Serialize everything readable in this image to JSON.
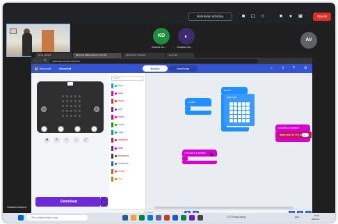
{
  "meet": {
    "record_button": "Nahrávání schůzky",
    "leave_button": "Opustit",
    "participants": [
      {
        "initials": "KD",
        "name": "Kristina Do...",
        "color": "#1e8e3e"
      },
      {
        "initials": "",
        "name": "Oswaldo Na...",
        "color": "#3c2a6e"
      },
      {
        "initials": "AV",
        "name": "",
        "color": "#5f6368"
      }
    ],
    "presenter_label": "Oswaldo Nazarov"
  },
  "browser": {
    "tabs": [
      "Nová záložka",
      "Microsoft MakeCode for micro:bit",
      "Microbit V2 | Tutorial",
      "Nový tab"
    ],
    "url": "makecode.microbit.org/#editor"
  },
  "makecode": {
    "brand": "Microsoft",
    "product": "micro:bit",
    "blocks_tab": "Blocks",
    "js_tab": "JavaScript",
    "download_label": "Download",
    "search_placeholder": "Search...",
    "project_name": "Untitled",
    "categories": [
      {
        "label": "Basic",
        "color": "#1e90ff"
      },
      {
        "label": "Input",
        "color": "#d400d4"
      },
      {
        "label": "Music",
        "color": "#e63022"
      },
      {
        "label": "Led",
        "color": "#5c2d91"
      },
      {
        "label": "Radio",
        "color": "#e3008c"
      },
      {
        "label": "Loops",
        "color": "#00aa00"
      },
      {
        "label": "Logic",
        "color": "#00a4a6"
      },
      {
        "label": "Variables",
        "color": "#dc143c"
      },
      {
        "label": "Math",
        "color": "#9400d3"
      },
      {
        "label": "Advanced",
        "color": "#3c3c3c"
      },
      {
        "label": "Functions",
        "color": "#3455db"
      },
      {
        "label": "Arrays",
        "color": "#e65722"
      },
      {
        "label": "Text",
        "color": "#b8860b"
      }
    ],
    "blocks": {
      "on_start": "on start",
      "forever": "forever",
      "show_leds": "show leds",
      "on_button_a": "on button A ▾ pressed",
      "on_button_b": "on button A ▾ pressed",
      "digital_write": "digital write pin P0 ▾ to",
      "digital_value": "0"
    }
  },
  "taskbar": {
    "search": "Sem zadejte hledaný výraz",
    "weather": "17°C  Mostly cloudy",
    "lang": "ENG",
    "time": "19:04",
    "date": "2022-03"
  }
}
